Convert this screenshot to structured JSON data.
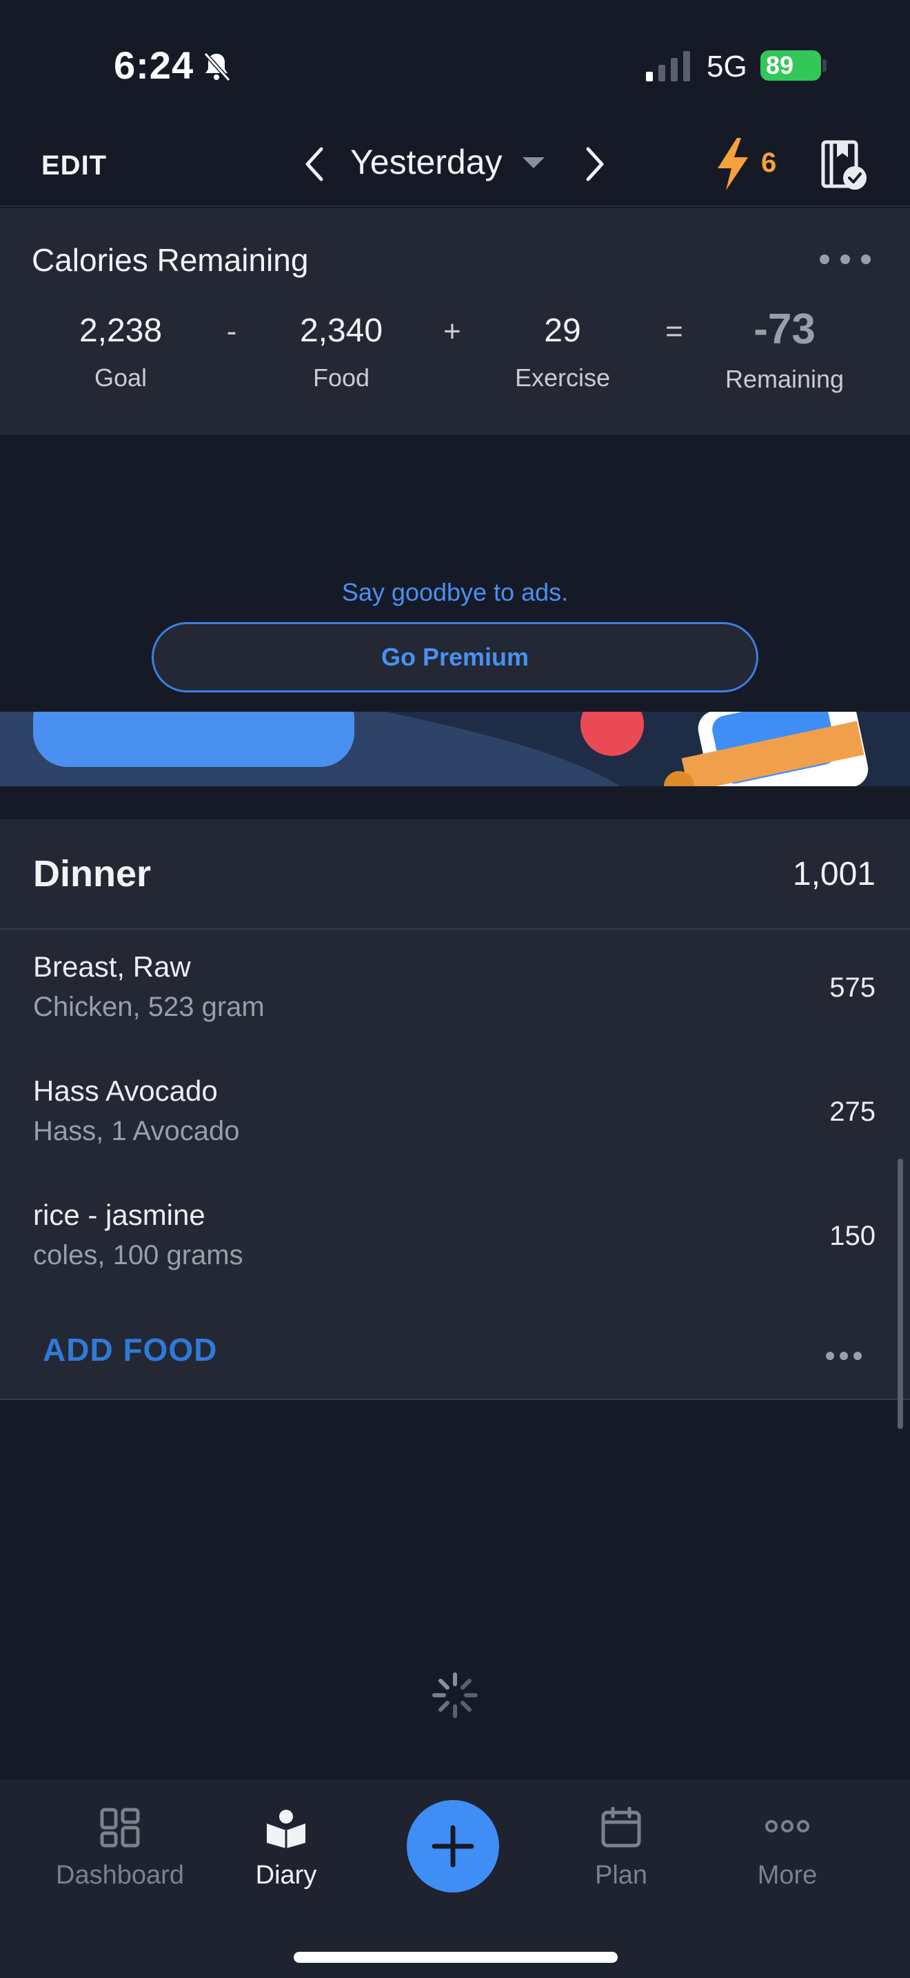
{
  "status_bar": {
    "time": "6:24",
    "network": "5G",
    "battery": "89"
  },
  "nav": {
    "edit_label": "EDIT",
    "date_label": "Yesterday",
    "streak_count": "6"
  },
  "calories": {
    "title": "Calories Remaining",
    "goal_value": "2,238",
    "goal_label": "Goal",
    "minus": "-",
    "food_value": "2,340",
    "food_label": "Food",
    "plus": "+",
    "exercise_value": "29",
    "exercise_label": "Exercise",
    "equals": "=",
    "remaining_value": "-73",
    "remaining_label": "Remaining"
  },
  "ad": {
    "text": "Say goodbye to ads.",
    "button_label": "Go Premium"
  },
  "dinner": {
    "title": "Dinner",
    "total": "1,001",
    "items": [
      {
        "name": "Breast, Raw",
        "desc": "Chicken, 523 gram",
        "calories": "575"
      },
      {
        "name": "Hass Avocado",
        "desc": "Hass, 1 Avocado",
        "calories": "275"
      },
      {
        "name": "rice - jasmine",
        "desc": "coles, 100 grams",
        "calories": "150"
      }
    ],
    "add_food_label": "ADD FOOD"
  },
  "tabbar": {
    "dashboard": "Dashboard",
    "diary": "Diary",
    "plan": "Plan",
    "more": "More"
  },
  "colors": {
    "accent_blue": "#3f8ef5",
    "streak_orange": "#f5a23a",
    "battery_green": "#33c759"
  }
}
